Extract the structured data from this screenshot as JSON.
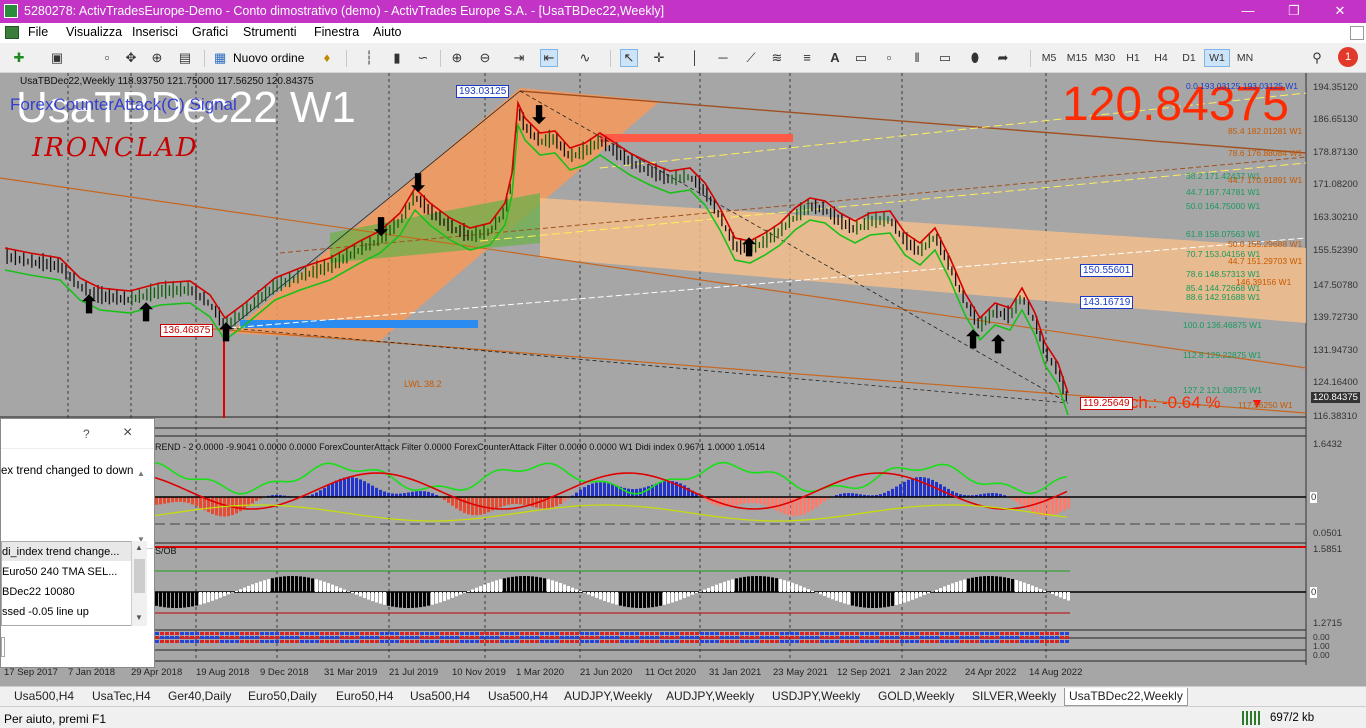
{
  "window": {
    "title": "5280278: ActivTradesEurope-Demo - Conto dimostrativo (demo) - ActivTrades Europe S.A. - [UsaTBDec22,Weekly]",
    "icon": "terminal-icon",
    "minimize_icon": "minimize-icon",
    "restore_icon": "restore-icon",
    "close_icon": "close-icon"
  },
  "menu": [
    "File",
    "Visualizza",
    "Inserisci",
    "Grafici",
    "Strumenti",
    "Finestra",
    "Aiuto"
  ],
  "toolbar": {
    "new_order": "Nuovo ordine",
    "timeframes": [
      "M5",
      "M15",
      "M30",
      "H1",
      "H4",
      "D1",
      "W1",
      "MN"
    ],
    "active_timeframe": "W1",
    "notification_count": "1"
  },
  "chart": {
    "header": "UsaTBDec22,Weekly  118.93750 121.75000 117.56250 120.84375",
    "big_symbol": "UsaTBDec22 W1",
    "indicator_name": "ForexCounterAttack(C) Signal",
    "signature": "IRONCLAD",
    "big_price": "120.84375",
    "change_text": "% ch.: -0.64 %",
    "price_labels": [
      "194.35120",
      "186.65130",
      "178.87130",
      "171.08200",
      "163.30210",
      "155.52390",
      "147.50780",
      "139.72730",
      "131.94730",
      "124.16400",
      "120.84375",
      "116.38310"
    ],
    "boxed_labels": {
      "top": "193.03125",
      "left": "136.46875",
      "r1": "150.55601",
      "r2": "143.16719",
      "cur": "119.25649"
    },
    "fib_labels": [
      "0.0 193.03125 193.03125 W1",
      "85.4 182.01281 W1",
      "78.6 176.88084 W1",
      "38.2 171.42437 W1",
      "44.7 170.91891 W1",
      "44.7 167.74781 W1",
      "50.0 164.75000 W1",
      "61.8 158.07563 W1",
      "50.0 155.29688 W1",
      "70.7 153.04156 W1",
      "44.7 151.29703 W1",
      "78.6 148.57313 W1",
      "85.4 144.72668 W1",
      "88.6 142.91688 W1",
      "146.39156 W1",
      "100.0 136.46875 W1",
      "112.8 129.22875 W1",
      "127.2 121.08375 W1",
      "117.56250 W1"
    ],
    "lwl": "LWL 38.2",
    "indicator1": "REND - 2 0.0000 -9.9041 0.0000 0.0000  ForexCounterAttack Filter 0.0000  ForexCounterAttack Filter 0.0000 0.0000  W1 Didi index 0.9671 1.0000 1.0514",
    "ind1_scale": [
      "1.6432",
      "0",
      "0.0501"
    ],
    "ind2_label": "S/OB",
    "ind2_scale": [
      "1.5851",
      "0",
      "1.2715"
    ],
    "ind3_scale": [
      "0.00",
      "1.00",
      "0.00"
    ],
    "dates": [
      "17 Sep 2017",
      "7 Jan 2018",
      "29 Apr 2018",
      "19 Aug 2018",
      "9 Dec 2018",
      "31 Mar 2019",
      "21 Jul 2019",
      "10 Nov 2019",
      "1 Mar 2020",
      "21 Jun 2020",
      "11 Oct 2020",
      "31 Jan 2021",
      "23 May 2021",
      "12 Sep 2021",
      "2 Jan 2022",
      "24 Apr 2022",
      "14 Aug 2022"
    ],
    "colors": {
      "background": "#a6a6a6",
      "price_red": "#ff2a00",
      "band_orange": "#f7c08a",
      "bull_green": "#18c018",
      "bear_red": "#dd0000",
      "fib_blue": "#1a3cc8",
      "label_cyan": "#2fd8e8"
    }
  },
  "alert": {
    "help": "?",
    "close": "×",
    "message": "ex trend changed to down",
    "items": [
      "di_index trend change...",
      "Euro50 240 TMA   SEL...",
      "BDec22 10080",
      "ssed -0.05 line up"
    ]
  },
  "tabs": [
    "Usa500,H4",
    "UsaTec,H4",
    "Ger40,Daily",
    "Euro50,Daily",
    "Euro50,H4",
    "Usa500,H4",
    "Usa500,H4",
    "AUDJPY,Weekly",
    "AUDJPY,Weekly",
    "USDJPY,Weekly",
    "GOLD,Weekly",
    "SILVER,Weekly",
    "UsaTBDec22,Weekly"
  ],
  "active_tab": "UsaTBDec22,Weekly",
  "status": {
    "help": "Per aiuto, premi F1",
    "traffic": "697/2 kb"
  }
}
